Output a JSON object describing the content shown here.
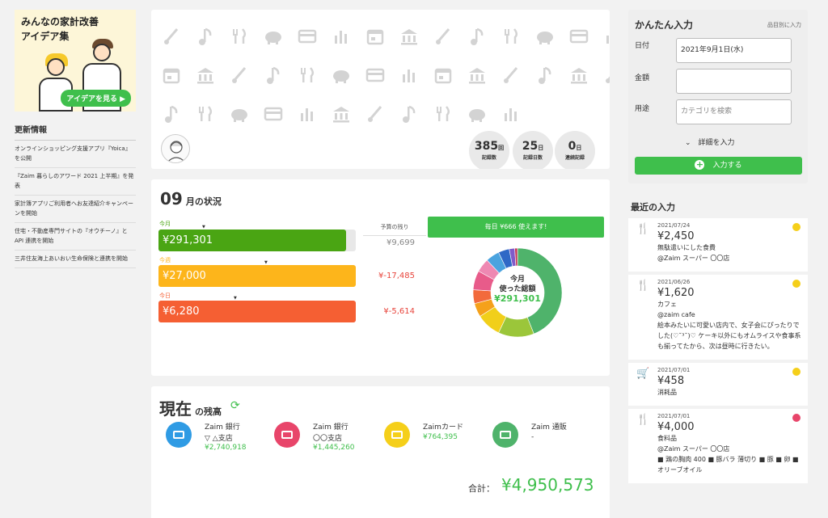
{
  "banner": {
    "title_line1": "みんなの家計改善",
    "title_line2": "アイデア集",
    "button": "アイデアを見る ▶"
  },
  "news": {
    "title": "更新情報",
    "items": [
      "オンラインショッピング支援アプリ『Yoica』を公開",
      "『Zaim 暮らしのアワード 2021 上半期』を発表",
      "家計簿アプリご利用者へお友達紹介キャンペーンを開始",
      "住宅・不動産専門サイトの『オウチーノ』と API 連携を開始",
      "三井住友海上あいおい生命保険と連携を開始"
    ]
  },
  "stats": [
    {
      "num": "385",
      "unit": "回",
      "label": "記録数"
    },
    {
      "num": "25",
      "unit": "日",
      "label": "記録日数"
    },
    {
      "num": "0",
      "unit": "日",
      "label": "連続記録"
    }
  ],
  "month": {
    "number": "09",
    "suffix": "月の状況",
    "remain_header": "予算の残り",
    "bars": [
      {
        "label": "今月",
        "value": "¥291,301",
        "fill": 0.95,
        "color": "#4aa513",
        "label_color": "#4aa513",
        "remain": "¥9,699",
        "remain_color": "#888888"
      },
      {
        "label": "今週",
        "value": "¥27,000",
        "fill": 1.0,
        "color": "#fdb51b",
        "label_color": "#fdb51b",
        "remain": "¥-17,485",
        "remain_color": "#e8453c"
      },
      {
        "label": "今日",
        "value": "¥6,280",
        "fill": 1.0,
        "color": "#f55f33",
        "label_color": "#f55f33",
        "remain": "¥-5,614",
        "remain_color": "#e8453c"
      }
    ],
    "daily": "毎日 ¥666 使えます!",
    "donut_line1": "今月",
    "donut_line2": "使った総額",
    "donut_amount": "¥291,301"
  },
  "chart_data": {
    "type": "pie",
    "values": [
      44,
      13,
      9,
      5,
      5,
      7,
      5,
      5,
      4,
      2,
      1
    ],
    "colors": [
      "#4fb36b",
      "#9bc63a",
      "#f1cf1a",
      "#f5a11b",
      "#f26a3c",
      "#e85b8a",
      "#ee88b2",
      "#4aa3df",
      "#2f68c6",
      "#7f5bc9",
      "#c83a5a"
    ]
  },
  "balance": {
    "title": "現在",
    "subtitle": "の残高",
    "refresh_icon": "⟳",
    "accounts": [
      {
        "name": "Zaim 銀行\n▽ △支店",
        "amount": "¥2,740,918",
        "color": "#2f9be4",
        "icon": "bank-icon"
      },
      {
        "name": "Zaim 銀行\n〇〇支店",
        "amount": "¥1,445,260",
        "color": "#e8456a",
        "icon": "bank-icon"
      },
      {
        "name": "Zaimカード",
        "amount": "¥764,395",
        "color": "#f5cf1a",
        "icon": "card-icon"
      },
      {
        "name": "Zaim 通販",
        "amount": "-",
        "color": "#4fb36b",
        "icon": "moneybag-icon"
      }
    ],
    "total_label": "合計：",
    "total": "¥4,950,573"
  },
  "quick_input": {
    "title": "かんたん入力",
    "sub": "品目別に入力",
    "date_label": "日付",
    "date_value": "2021年9月1日(水)",
    "amount_label": "金額",
    "amount_value": "",
    "category_label": "用途",
    "category_placeholder": "カテゴリを検索",
    "detail": "⌄　詳細を入力",
    "submit": "入力する"
  },
  "recent": {
    "title": "最近の入力",
    "entries": [
      {
        "date": "2021/07/24",
        "amount": "¥2,450",
        "text": "無駄遣いにした食費\n@Zaim スーパー 〇〇店",
        "icon": "fork-knife-icon",
        "badge": "#f5cf1a"
      },
      {
        "date": "2021/06/26",
        "amount": "¥1,620",
        "text": "カフェ\n@zaim cafe\n絵本みたいに可愛い店内で、女子会にぴったりでした(♡˘³˘)♡ ケーキ以外にもオムライスや食事系も揃ってたから、次は昼時に行きたい。",
        "icon": "fork-knife-icon",
        "badge": "#f5cf1a"
      },
      {
        "date": "2021/07/01",
        "amount": "¥458",
        "text": "消耗品",
        "icon": "cart-icon",
        "badge": "#f5cf1a"
      },
      {
        "date": "2021/07/01",
        "amount": "¥4,000",
        "text": "食料品\n@Zaim スーパー 〇〇店\n■ 鶏の胸肉 400 ■ 豚バラ 薄切り ■ 豚 ■ 卵 ■ オリーブオイル",
        "icon": "fork-knife-icon",
        "badge": "#e8456a"
      }
    ]
  }
}
